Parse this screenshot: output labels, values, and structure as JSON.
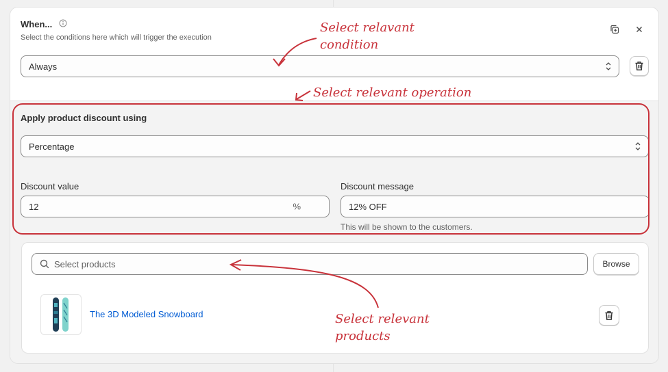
{
  "when": {
    "title": "When...",
    "subtitle": "Select the conditions here which will trigger the execution",
    "condition_value": "Always"
  },
  "operation": {
    "title": "Apply product discount using",
    "type_value": "Percentage",
    "discount_value_label": "Discount value",
    "discount_value": "12",
    "discount_value_suffix": "%",
    "discount_message_label": "Discount message",
    "discount_message": "12% OFF",
    "discount_message_help": "This will be shown to the customers."
  },
  "products": {
    "search_placeholder": "Select products",
    "browse_label": "Browse",
    "items": [
      {
        "title": "The 3D Modeled Snowboard"
      }
    ]
  },
  "annotations": {
    "condition_line1": "Select relavant",
    "condition_line2": "condition",
    "operation": "Select relevant operation",
    "products_line1": "Select relevant",
    "products_line2": "products",
    "color": "#c8323a"
  },
  "colors": {
    "link": "#005bd3",
    "annotation": "#c8323a",
    "border": "#8a8a8a"
  }
}
